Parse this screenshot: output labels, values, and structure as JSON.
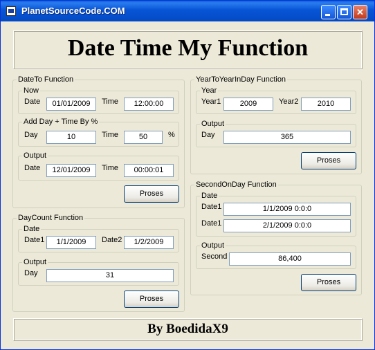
{
  "window": {
    "title": "PlanetSourceCode.COM"
  },
  "header": {
    "title": "Date Time My Function"
  },
  "footer": {
    "author": "By BoedidaX9"
  },
  "dateto": {
    "legend": "DateTo Function",
    "now": {
      "legend": "Now",
      "date_label": "Date",
      "date_value": "01/01/2009",
      "time_label": "Time",
      "time_value": "12:00:00"
    },
    "add": {
      "legend": "Add Day + Time By %",
      "day_label": "Day",
      "day_value": "10",
      "time_label": "Time",
      "time_value": "50",
      "percent": "%"
    },
    "output": {
      "legend": "Output",
      "date_label": "Date",
      "date_value": "12/01/2009",
      "time_label": "Time",
      "time_value": "00:00:01"
    },
    "button": "Proses"
  },
  "daycount": {
    "legend": "DayCount Function",
    "date": {
      "legend": "Date",
      "date1_label": "Date1",
      "date1_value": "1/1/2009",
      "date2_label": "Date2",
      "date2_value": "1/2/2009"
    },
    "output": {
      "legend": "Output",
      "day_label": "Day",
      "day_value": "31"
    },
    "button": "Proses"
  },
  "yeartoyear": {
    "legend": "YearToYearInDay Function",
    "year": {
      "legend": "Year",
      "year1_label": "Year1",
      "year1_value": "2009",
      "year2_label": "Year2",
      "year2_value": "2010"
    },
    "output": {
      "legend": "Output",
      "day_label": "Day",
      "day_value": "365"
    },
    "button": "Proses"
  },
  "secondonday": {
    "legend": "SecondOnDay Function",
    "date": {
      "legend": "Date",
      "date1_label": "Date1",
      "date1_value": "1/1/2009 0:0:0",
      "date2_label": "Date1",
      "date2_value": "2/1/2009 0:0:0"
    },
    "output": {
      "legend": "Output",
      "second_label": "Second",
      "second_value": "86,400"
    },
    "button": "Proses"
  }
}
